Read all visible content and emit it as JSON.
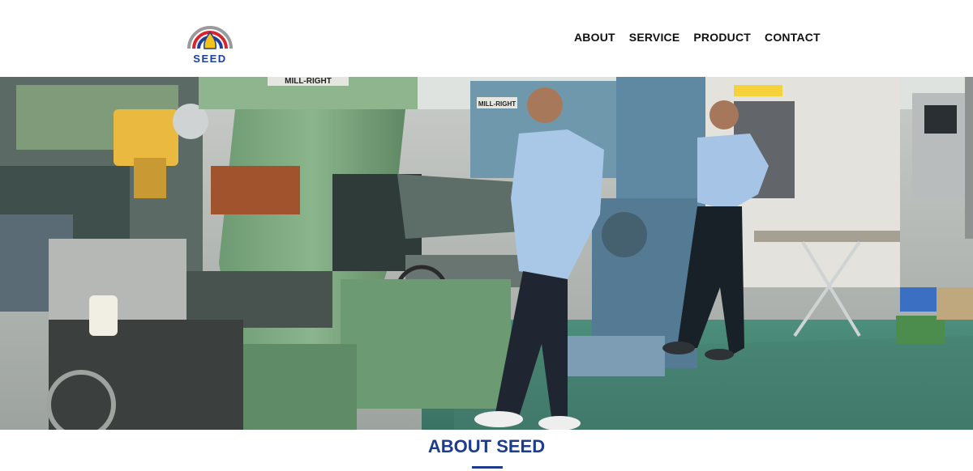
{
  "brand": {
    "name": "SEED",
    "colors": {
      "arc_outer": "#9a9a9a",
      "arc_red": "#d9242b",
      "arc_blue": "#1d3f9a",
      "flame": "#f2c21b"
    }
  },
  "nav": {
    "items": [
      {
        "label": "ABOUT"
      },
      {
        "label": "SERVICE"
      },
      {
        "label": "PRODUCT"
      },
      {
        "label": "CONTACT"
      }
    ]
  },
  "hero": {
    "plates": {
      "small": "MILL-RIGHT",
      "large": "MILL-RIGHT"
    }
  },
  "about": {
    "title": "ABOUT SEED",
    "accent_color": "#1e3c8c"
  }
}
